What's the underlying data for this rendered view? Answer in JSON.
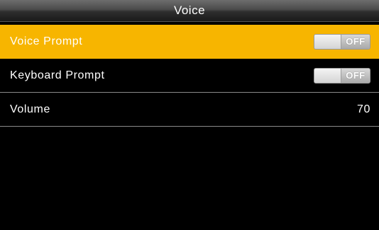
{
  "header": {
    "title": "Voice"
  },
  "menu": {
    "items": [
      {
        "label": "Voice Prompt",
        "toggle_state": "OFF",
        "selected": true
      },
      {
        "label": "Keyboard Prompt",
        "toggle_state": "OFF",
        "selected": false
      },
      {
        "label": "Volume",
        "value": "70",
        "selected": false
      }
    ]
  },
  "colors": {
    "highlight": "#f7b500",
    "background": "#000000",
    "text": "#ffffff"
  }
}
